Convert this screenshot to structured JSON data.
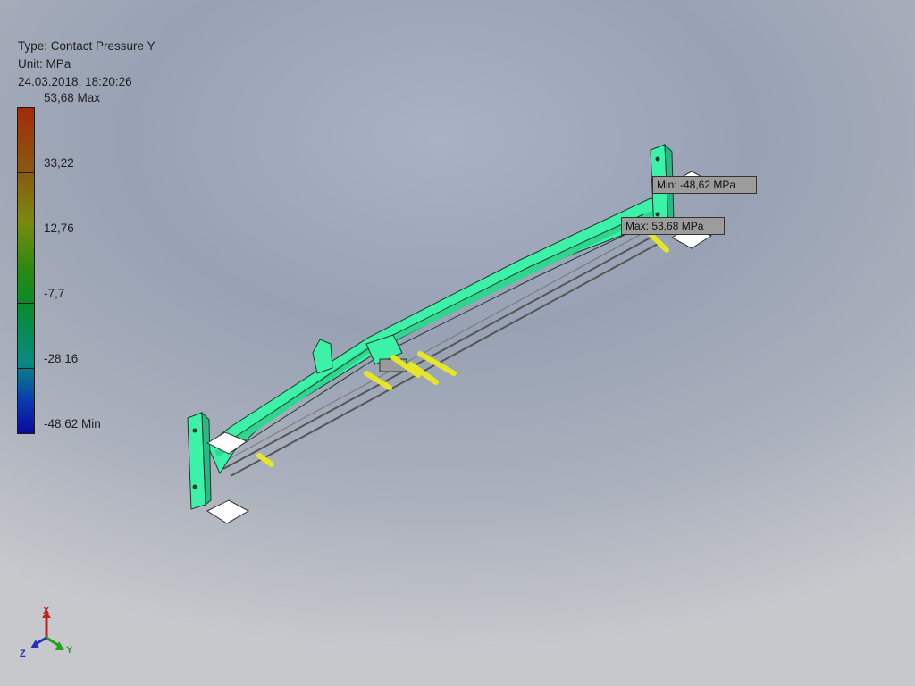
{
  "header": {
    "type_line": "Type: Contact Pressure Y",
    "unit_line": "Unit: MPa",
    "timestamp": "24.03.2018, 18:20:26"
  },
  "legend": {
    "max_label": "53,68 Max",
    "labels": [
      "33,22",
      "12,76",
      "-7,7",
      "-28,16"
    ],
    "min_label": "-48,62 Min"
  },
  "callouts": {
    "min_label": "Min: -48,62 MPa",
    "max_label": "Max: 53,68 MPa"
  },
  "triad": {
    "x": "X",
    "y": "Y",
    "z": "Z"
  },
  "colors": {
    "model": "#3cf2a8",
    "pins": "#e6e628",
    "background": "#a8b2c4"
  }
}
